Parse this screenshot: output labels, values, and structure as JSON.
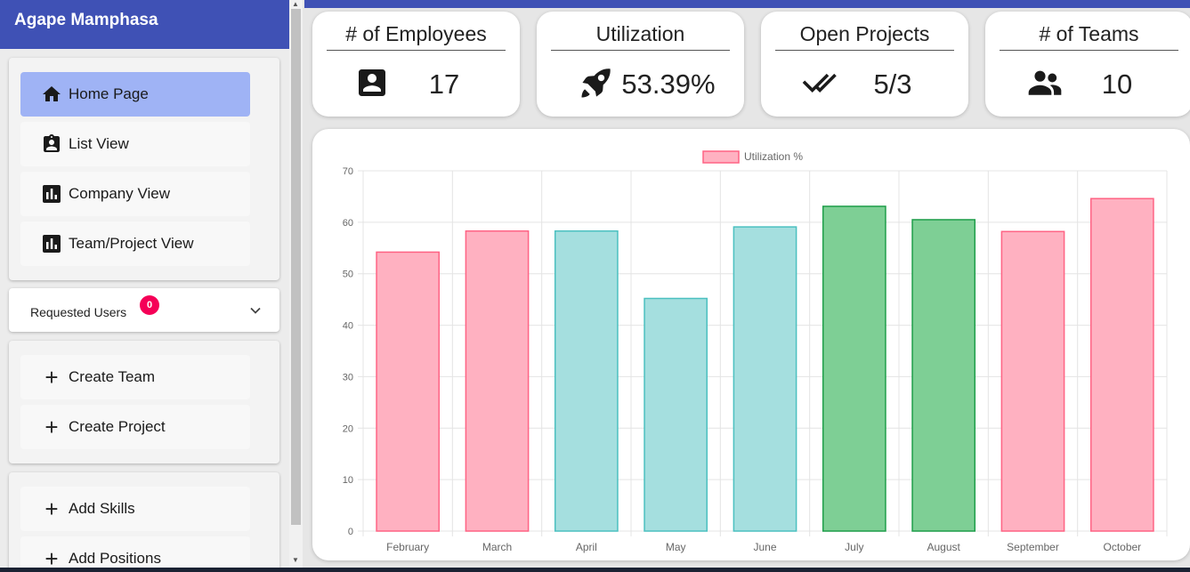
{
  "sidebar": {
    "user_name": "Agape Mamphasa",
    "nav": [
      {
        "label": "Home Page",
        "icon": "home-icon",
        "active": true
      },
      {
        "label": "List View",
        "icon": "badge-icon",
        "active": false
      },
      {
        "label": "Company View",
        "icon": "bar-chart-icon",
        "active": false
      },
      {
        "label": "Team/Project View",
        "icon": "bar-chart-icon",
        "active": false
      }
    ],
    "requested_users": {
      "label": "Requested Users",
      "count": "0"
    },
    "create": [
      {
        "label": "Create Team",
        "icon": "plus-icon"
      },
      {
        "label": "Create Project",
        "icon": "plus-icon"
      }
    ],
    "add": [
      {
        "label": "Add Skills",
        "icon": "plus-icon"
      },
      {
        "label": "Add Positions",
        "icon": "plus-icon"
      }
    ]
  },
  "stats": [
    {
      "title": "# of Employees",
      "value": "17",
      "icon": "contact-card-icon"
    },
    {
      "title": "Utilization",
      "value": "53.39%",
      "icon": "rocket-icon"
    },
    {
      "title": "Open Projects",
      "value": "5/3",
      "icon": "double-check-icon"
    },
    {
      "title": "# of Teams",
      "value": "10",
      "icon": "people-icon"
    }
  ],
  "colors": {
    "accent": "#3f51b5",
    "active_nav": "#9fb3f5",
    "badge": "#f50057",
    "bar_pink_fill": "#ffb1c1",
    "bar_pink_border": "#ff6384",
    "bar_teal_fill": "#a5dfdf",
    "bar_teal_border": "#4bc0c0",
    "bar_green_fill": "#7ecf95",
    "bar_green_border": "#1e9e4a"
  },
  "chart_data": {
    "type": "bar",
    "categories": [
      "February",
      "March",
      "April",
      "May",
      "June",
      "July",
      "August",
      "September",
      "October"
    ],
    "series": [
      {
        "name": "Utilization %",
        "values": [
          54.2,
          58.3,
          58.3,
          45.2,
          59.1,
          63.1,
          60.5,
          58.2,
          64.6
        ]
      }
    ],
    "bar_colors": [
      "pink",
      "pink",
      "teal",
      "teal",
      "teal",
      "green",
      "green",
      "pink",
      "pink"
    ],
    "ylim": [
      0,
      70
    ],
    "yticks": [
      0,
      10,
      20,
      30,
      40,
      50,
      60,
      70
    ],
    "grid": true,
    "legend": "top-center"
  }
}
